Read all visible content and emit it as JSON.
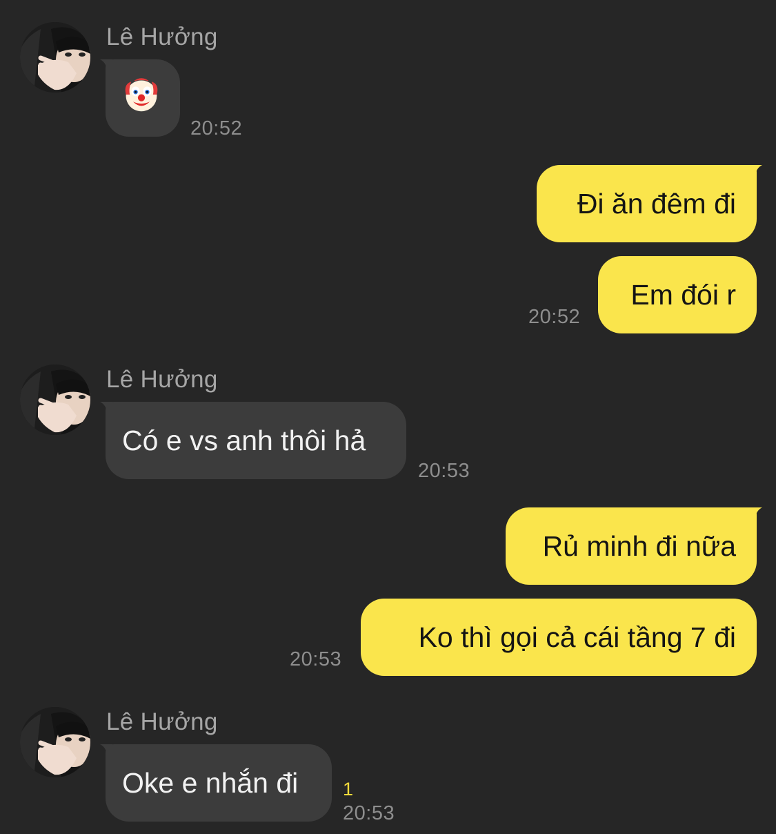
{
  "colors": {
    "background": "#262626",
    "incoming_bubble": "#3c3c3c",
    "outgoing_bubble": "#fae54c",
    "unread_indicator": "#f7dc3b"
  },
  "messages": [
    {
      "direction": "incoming",
      "sender": "Lê Hưởng",
      "avatar": "profile-photo",
      "kind": "emoji",
      "icon": "clown-face-emoji",
      "time": "20:52"
    },
    {
      "direction": "outgoing",
      "text": "Đi ăn đêm đi"
    },
    {
      "direction": "outgoing",
      "text": "Em đói r",
      "time": "20:52"
    },
    {
      "direction": "incoming",
      "sender": "Lê Hưởng",
      "avatar": "profile-photo",
      "text": "Có e vs anh thôi hả",
      "time": "20:53"
    },
    {
      "direction": "outgoing",
      "text": "Rủ minh đi nữa"
    },
    {
      "direction": "outgoing",
      "text": "Ko thì gọi cả cái tầng 7 đi",
      "time": "20:53"
    },
    {
      "direction": "incoming",
      "sender": "Lê Hưởng",
      "avatar": "profile-photo",
      "text": "Oke e nhắn đi",
      "time": "20:53",
      "unread_count": "1"
    }
  ]
}
